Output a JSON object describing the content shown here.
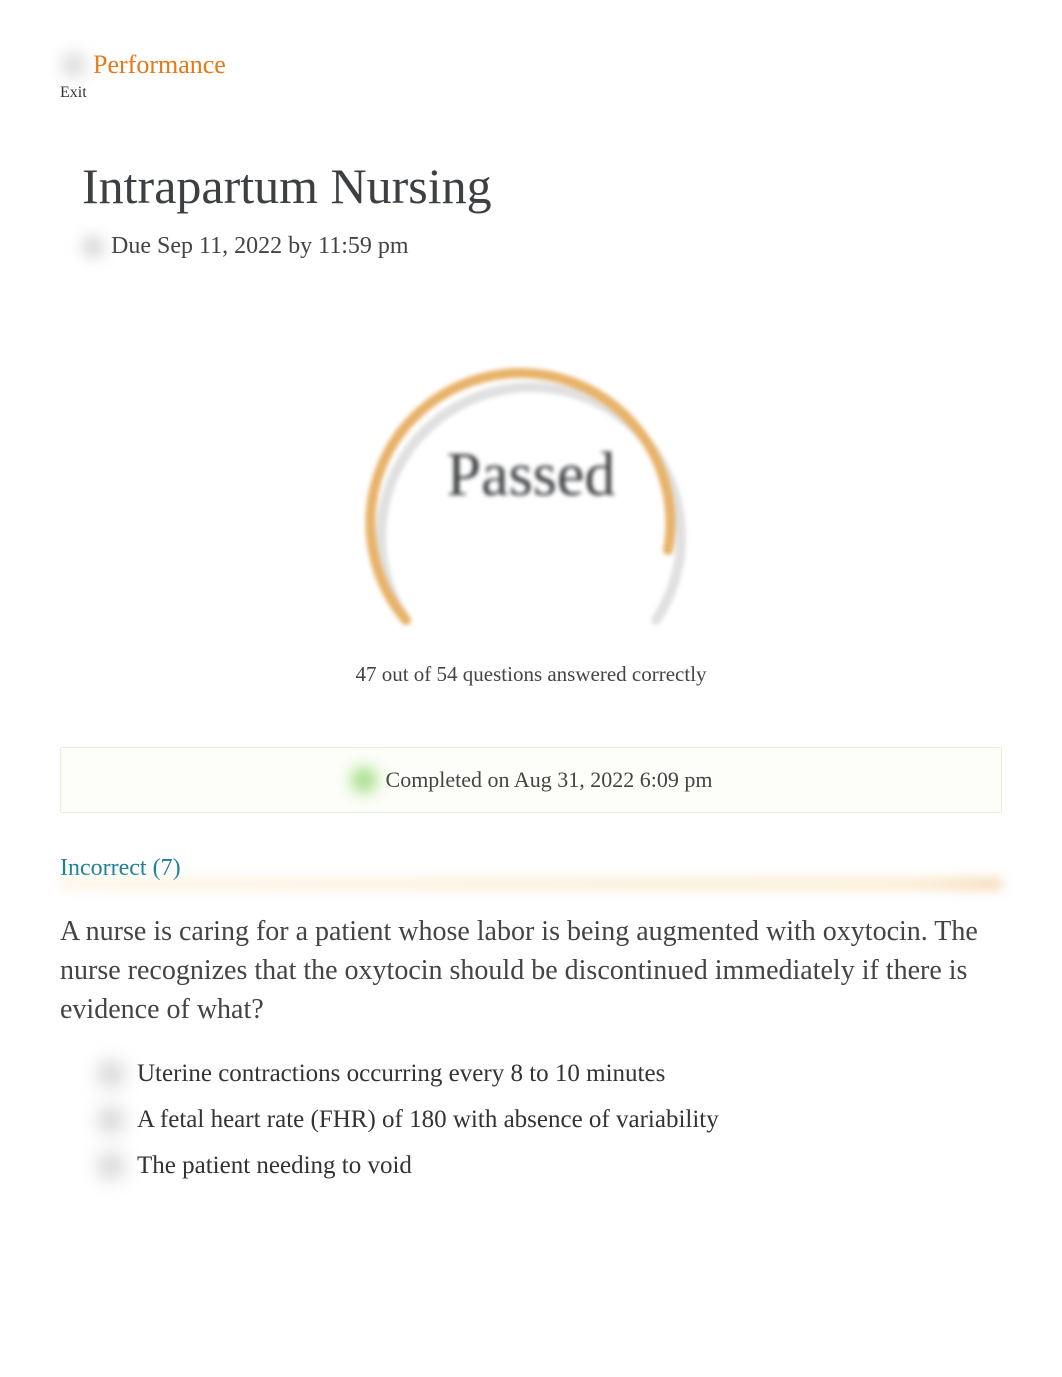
{
  "header": {
    "link_label": "Performance",
    "exit_label": "Exit"
  },
  "assignment": {
    "title": "Intrapartum Nursing",
    "due_text": "Due Sep 11, 2022 by 11:59 pm"
  },
  "result": {
    "status": "Passed",
    "score_text": "47 out of 54 questions answered correctly",
    "completed_text": "Completed on Aug 31, 2022 6:09 pm"
  },
  "section": {
    "label": "Incorrect (7)"
  },
  "question": {
    "text": "A nurse is caring for a patient whose labor is being augmented with oxytocin. The nurse recognizes that the oxytocin should be discontinued immediately if there is evidence of what?",
    "options": [
      "Uterine contractions occurring every 8 to 10 minutes",
      "A fetal heart rate (FHR) of 180 with absence of variability",
      "The patient needing to void"
    ]
  }
}
